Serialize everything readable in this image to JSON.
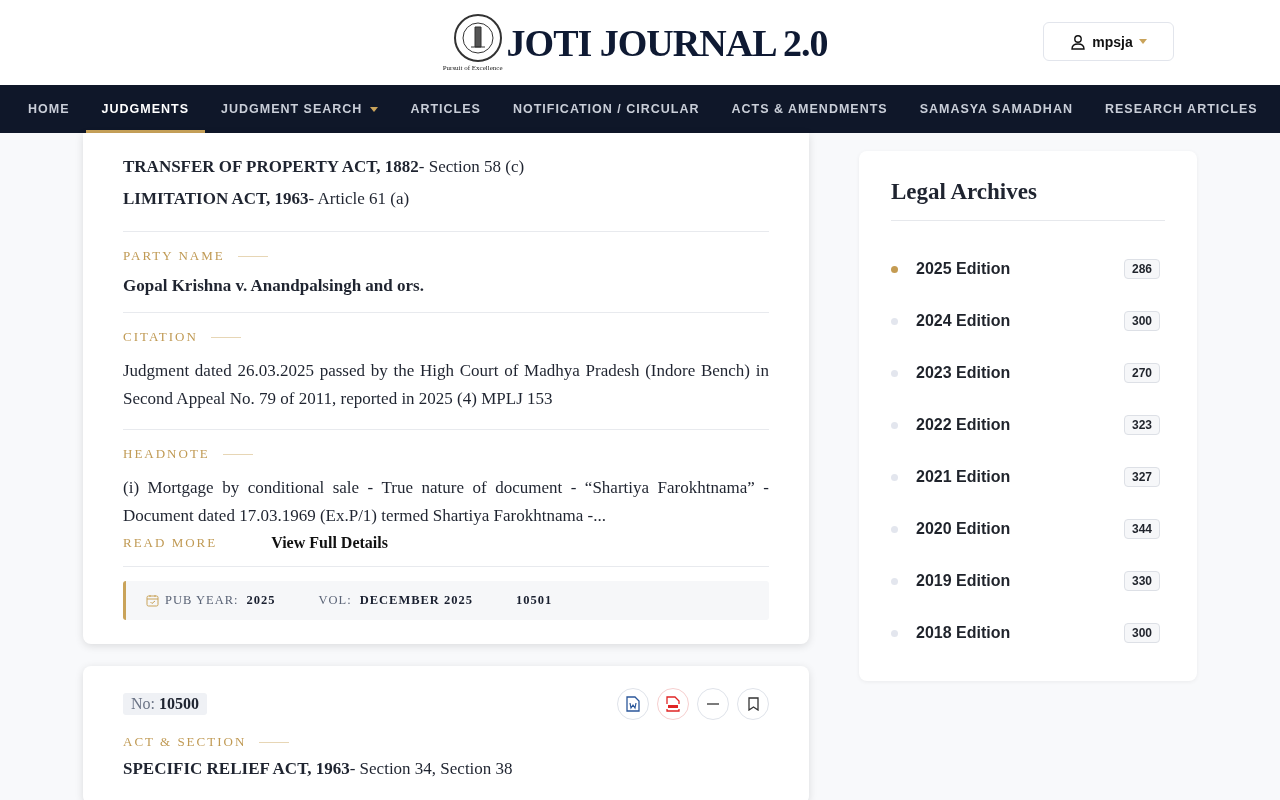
{
  "header": {
    "logo_title": "JOTI JOURNAL 2.0",
    "logo_tagline": "Pursuit of Excellence",
    "user": "mpsja"
  },
  "nav": [
    {
      "label": "HOME",
      "selected": false,
      "dropdown": false
    },
    {
      "label": "JUDGMENTS",
      "selected": true,
      "dropdown": false
    },
    {
      "label": "JUDGMENT SEARCH",
      "selected": false,
      "dropdown": true
    },
    {
      "label": "ARTICLES",
      "selected": false,
      "dropdown": false
    },
    {
      "label": "NOTIFICATION / CIRCULAR",
      "selected": false,
      "dropdown": false
    },
    {
      "label": "ACTS & AMENDMENTS",
      "selected": false,
      "dropdown": false
    },
    {
      "label": "SAMASYA SAMADHAN",
      "selected": false,
      "dropdown": false
    },
    {
      "label": "RESEARCH ARTICLES",
      "selected": false,
      "dropdown": false
    }
  ],
  "judgments": [
    {
      "acts": [
        "**TRANSFER OF PROPERTY ACT, 1882**- Section 58 (c)",
        "**LIMITATION ACT, 1963**- Article 61 (a)"
      ],
      "party_label": "PARTY NAME",
      "party": "Gopal Krishna v. Anandpalsingh and ors.",
      "citation_label": "CITATION",
      "citation": "Judgment dated 26.03.2025 passed by the High Court of Madhya Pradesh (Indore Bench) in Second Appeal No. 79 of 2011, reported in 2025 (4) MPLJ 153",
      "headnote_label": "HEADNOTE",
      "headnote": "(i) Mortgage by conditional sale - True nature of document - “Shartiya Farokhtnama” - Document dated 17.03.1969 (Ex.P/1) termed Shartiya Farokhtnama -...",
      "read_more": "READ MORE",
      "view_details": "View Full Details",
      "pub_year_label": "PUB YEAR:",
      "pub_year": "2025",
      "vol_label": "VOL:",
      "vol": "DECEMBER 2025",
      "number": "10501"
    },
    {
      "no_label": "No:",
      "no": "10500",
      "act_label": "ACT & SECTION",
      "acts": [
        "**SPECIFIC RELIEF ACT, 1963**- Section 34, Section 38"
      ]
    }
  ],
  "archives": {
    "title": "Legal Archives",
    "items": [
      {
        "label": "2025 Edition",
        "count": "286",
        "selected": true
      },
      {
        "label": "2024 Edition",
        "count": "300",
        "selected": false
      },
      {
        "label": "2023 Edition",
        "count": "270",
        "selected": false
      },
      {
        "label": "2022 Edition",
        "count": "323",
        "selected": false
      },
      {
        "label": "2021 Edition",
        "count": "327",
        "selected": false
      },
      {
        "label": "2020 Edition",
        "count": "344",
        "selected": false
      },
      {
        "label": "2019 Edition",
        "count": "330",
        "selected": false
      },
      {
        "label": "2018 Edition",
        "count": "300",
        "selected": false
      }
    ]
  }
}
